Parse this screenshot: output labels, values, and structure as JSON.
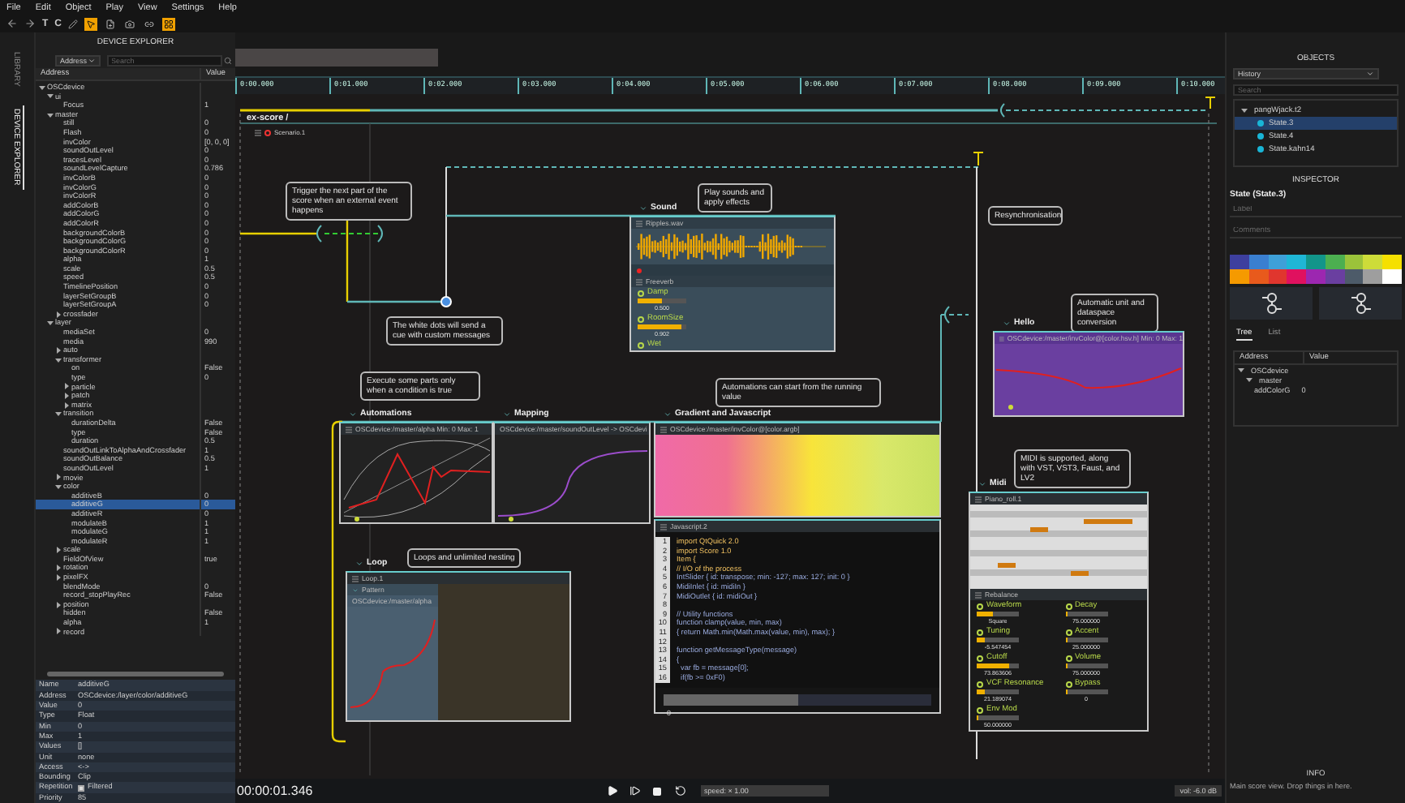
{
  "menu": [
    "File",
    "Edit",
    "Object",
    "Play",
    "View",
    "Settings",
    "Help"
  ],
  "toolbar": {
    "glyphs": [
      "T",
      "C"
    ],
    "tools": [
      {
        "kind": "select",
        "selected": true
      },
      {
        "kind": "create",
        "selected": false
      },
      {
        "kind": "play",
        "selected": false
      },
      {
        "kind": "link",
        "selected": false
      },
      {
        "kind": "layout",
        "selected": true
      }
    ]
  },
  "side_tabs": [
    {
      "label": "LIBRARY",
      "selected": false
    },
    {
      "label": "DEVICE EXPLORER",
      "selected": true
    }
  ],
  "device_explorer": {
    "title": "DEVICE EXPLORER",
    "filter": "Address",
    "search": {
      "placeholder": "Search"
    },
    "columns": [
      "Address",
      "Value"
    ],
    "tree": [
      {
        "label": "OSCdevice",
        "expanded": true,
        "selected": false,
        "children": [
          {
            "label": "ui",
            "expanded": true,
            "selected": false,
            "children": [
              {
                "label": "Focus",
                "value": "1",
                "selected": false
              }
            ]
          },
          {
            "label": "master",
            "expanded": true,
            "selected": false,
            "children": [
              {
                "label": "still",
                "value": "0",
                "selected": false
              },
              {
                "label": "Flash",
                "value": "0",
                "selected": false
              },
              {
                "label": "invColor",
                "value": "[0, 0, 0]",
                "selected": false
              },
              {
                "label": "soundOutLevel",
                "value": "0",
                "selected": false
              },
              {
                "label": "tracesLevel",
                "value": "0",
                "selected": false
              },
              {
                "label": "soundLevelCapture",
                "value": "0.786",
                "selected": false
              },
              {
                "label": "invColorB",
                "value": "0",
                "selected": false
              },
              {
                "label": "invColorG",
                "value": "0",
                "selected": false
              },
              {
                "label": "invColorR",
                "value": "0",
                "selected": false
              },
              {
                "label": "addColorB",
                "value": "0",
                "selected": false
              },
              {
                "label": "addColorG",
                "value": "0",
                "selected": false
              },
              {
                "label": "addColorR",
                "value": "0",
                "selected": false
              },
              {
                "label": "backgroundColorB",
                "value": "0",
                "selected": false
              },
              {
                "label": "backgroundColorG",
                "value": "0",
                "selected": false
              },
              {
                "label": "backgroundColorR",
                "value": "0",
                "selected": false
              },
              {
                "label": "alpha",
                "value": "1",
                "selected": false
              },
              {
                "label": "scale",
                "value": "0.5",
                "selected": false
              },
              {
                "label": "speed",
                "value": "0.5",
                "selected": false
              },
              {
                "label": "TimelinePosition",
                "value": "0",
                "selected": false
              },
              {
                "label": "layerSetGroupB",
                "value": "0",
                "selected": false
              },
              {
                "label": "layerSetGroupA",
                "value": "0",
                "selected": false
              },
              {
                "label": "crossfader",
                "expanded": false,
                "selected": false
              }
            ]
          },
          {
            "label": "layer",
            "expanded": true,
            "selected": false,
            "children": [
              {
                "label": "mediaSet",
                "value": "0",
                "selected": false
              },
              {
                "label": "media",
                "value": "990",
                "selected": false
              },
              {
                "label": "auto",
                "expanded": false,
                "selected": false
              },
              {
                "label": "transformer",
                "expanded": true,
                "selected": false,
                "children": [
                  {
                    "label": "on",
                    "value": "False",
                    "selected": false
                  },
                  {
                    "label": "type",
                    "value": "0",
                    "selected": false
                  },
                  {
                    "label": "particle",
                    "expanded": false,
                    "selected": false
                  },
                  {
                    "label": "patch",
                    "expanded": false,
                    "selected": false
                  },
                  {
                    "label": "matrix",
                    "expanded": false,
                    "selected": false
                  }
                ]
              },
              {
                "label": "transition",
                "expanded": true,
                "selected": false,
                "children": [
                  {
                    "label": "durationDelta",
                    "value": "False",
                    "selected": false
                  },
                  {
                    "label": "type",
                    "value": "False",
                    "selected": false
                  },
                  {
                    "label": "duration",
                    "value": "0.5",
                    "selected": false
                  }
                ]
              },
              {
                "label": "soundOutLinkToAlphaAndCrossfader",
                "value": "1",
                "selected": false
              },
              {
                "label": "soundOutBalance",
                "value": "0.5",
                "selected": false
              },
              {
                "label": "soundOutLevel",
                "value": "1",
                "selected": false
              },
              {
                "label": "movie",
                "expanded": false,
                "selected": false
              },
              {
                "label": "color",
                "expanded": true,
                "selected": false,
                "children": [
                  {
                    "label": "additiveB",
                    "value": "0",
                    "selected": false
                  },
                  {
                    "label": "additiveG",
                    "value": "0",
                    "selected": true
                  },
                  {
                    "label": "additiveR",
                    "value": "0",
                    "selected": false
                  },
                  {
                    "label": "modulateB",
                    "value": "1",
                    "selected": false
                  },
                  {
                    "label": "modulateG",
                    "value": "1",
                    "selected": false
                  },
                  {
                    "label": "modulateR",
                    "value": "1",
                    "selected": false
                  }
                ]
              },
              {
                "label": "scale",
                "expanded": false,
                "selected": false
              },
              {
                "label": "FieldOfView",
                "value": "true",
                "selected": false
              },
              {
                "label": "rotation",
                "expanded": false,
                "selected": false
              },
              {
                "label": "pixelFX",
                "expanded": false,
                "selected": false
              },
              {
                "label": "blendMode",
                "value": "0",
                "selected": false
              },
              {
                "label": "record_stopPlayRec",
                "value": "False",
                "selected": false
              },
              {
                "label": "position",
                "expanded": false,
                "selected": false
              },
              {
                "label": "hidden",
                "value": "False",
                "selected": false
              },
              {
                "label": "alpha",
                "value": "1",
                "selected": false
              },
              {
                "label": "record",
                "expanded": false,
                "selected": false
              }
            ]
          }
        ]
      }
    ],
    "properties": [
      {
        "name": "Name",
        "value": "additiveG"
      },
      {
        "name": "Address",
        "value": "OSCdevice:/layer/color/additiveG"
      },
      {
        "name": "Value",
        "value": "0"
      },
      {
        "name": "Type",
        "value": "Float"
      },
      {
        "name": "Min",
        "value": "0"
      },
      {
        "name": "Max",
        "value": "1"
      },
      {
        "name": "Values",
        "value": "[]"
      },
      {
        "name": "Unit",
        "value": "none"
      },
      {
        "name": "Access",
        "value": "<->"
      },
      {
        "name": "Bounding",
        "value": "Clip"
      },
      {
        "name": "Repetition",
        "value": "Filtered",
        "checked": true
      },
      {
        "name": "Priority",
        "value": "85"
      }
    ]
  },
  "timeline": {
    "ruler": [
      "0:00.000",
      "0:01.000",
      "0:02.000",
      "0:03.000",
      "0:04.000",
      "0:05.000",
      "0:06.000",
      "0:07.000",
      "0:08.000",
      "0:09.000",
      "0:10.000"
    ],
    "score_title": "ex-score /",
    "scenario": "Scenario.1"
  },
  "comments": [
    "Trigger the next part  of the score when an external event happens",
    "Play sounds and apply effects",
    "Resynchronisation",
    "The white dots will send a cue with custom messages",
    "Automatic unit and dataspace conversion",
    "Execute some parts only when a condition is true",
    "Automations can start from the running value",
    "MIDI is supported, along with VST, VST3, Faust, and LV2",
    "Loops and unlimited nesting"
  ],
  "processes": {
    "sound": {
      "title": "Sound",
      "file": "Ripples.wav",
      "effect": "Freeverb",
      "params": [
        {
          "label": "Damp",
          "level": 0.5,
          "reading": "0.500"
        },
        {
          "label": "RoomSize",
          "level": 0.9,
          "reading": "0.902"
        },
        {
          "label": "Wet"
        }
      ]
    },
    "hello": {
      "title": "Hello",
      "address": "OSCdevice:/master/invColor@[color.hsv.h]  Min: 0  Max: 1"
    },
    "automations": {
      "title": "Automations",
      "address": "OSCdevice:/master/alpha  Min: 0  Max: 1"
    },
    "mapping": {
      "title": "Mapping",
      "address": "OSCdevice:/master/soundOutLevel -> OSCdevi"
    },
    "gradient": {
      "title": "Gradient and Javascript",
      "address": "OSCdevice:/master/invColor@[color.argb]"
    },
    "javascript": {
      "title": "Javascript.2",
      "lines": [
        {
          "n": "1",
          "text": "import QtQuick 2.0"
        },
        {
          "n": "2",
          "text": "import Score 1.0"
        },
        {
          "n": "3",
          "text": "Item {"
        },
        {
          "n": "4",
          "text": "// I/O of the process"
        },
        {
          "n": "5",
          "text": "IntSlider { id: transpose; min: -127; max: 127; init: 0 }"
        },
        {
          "n": "6",
          "text": "MidiInlet { id: midiIn }"
        },
        {
          "n": "7",
          "text": "MidiOutlet { id: midiOut }"
        },
        {
          "n": "8"
        },
        {
          "n": "9",
          "text": "// Utility functions"
        },
        {
          "n": "10",
          "text": "function clamp(value, min, max)"
        },
        {
          "n": "11",
          "text": "{ return Math.min(Math.max(value, min), max); }"
        },
        {
          "n": "12"
        },
        {
          "n": "13",
          "text": "function getMessageType(message)"
        },
        {
          "n": "14",
          "text": "{"
        },
        {
          "n": "15",
          "text": "  var fb = message[0];"
        },
        {
          "n": "16",
          "text": "  if(fb >= 0xF0)"
        }
      ],
      "slider": {
        "level": 0.5,
        "reading": "0"
      }
    },
    "loop": {
      "title": "Loop",
      "name": "Loop.1",
      "pattern": "Pattern",
      "address": "OSCdevice:/master/alpha"
    },
    "midi": {
      "title": "Midi",
      "roll": "Piano_roll.1",
      "synth": "Rebalance",
      "params": [
        {
          "label": "Waveform",
          "level": 0.4,
          "reading": "Square"
        },
        {
          "label": "Decay",
          "level": 0,
          "reading": "75.000000"
        },
        {
          "label": "Tuning",
          "level": 0.2,
          "reading": "-5.547454"
        },
        {
          "label": "Accent",
          "level": 0,
          "reading": "25.000000"
        },
        {
          "label": "Cutoff",
          "level": 0.75,
          "reading": "73.863606"
        },
        {
          "label": "Volume",
          "level": 0,
          "reading": "75.000000"
        },
        {
          "label": "VCF Resonance",
          "level": 0.2,
          "reading": "21.189074"
        },
        {
          "label": "Bypass",
          "level": 0,
          "reading": "0"
        },
        {
          "label": "Env Mod",
          "level": 0,
          "reading": "50.000000"
        }
      ]
    }
  },
  "transport": {
    "time": "00:00:01.346",
    "speed": "speed: × 1.00",
    "volume": "vol: -6.0 dB"
  },
  "objects": {
    "title": "OBJECTS",
    "dropdown": "History",
    "search": {
      "placeholder": "Search"
    },
    "tree": [
      {
        "label": "pangWjack.t2",
        "expanded": true,
        "selected": false,
        "children": [
          {
            "label": "State.3",
            "selected": true
          },
          {
            "label": "State.4",
            "selected": false
          },
          {
            "label": "State.kahn14",
            "selected": false
          }
        ]
      }
    ]
  },
  "inspector": {
    "title": "INSPECTOR",
    "heading": "State (State.3)",
    "label": {
      "placeholder": "Label"
    },
    "comments": {
      "placeholder": "Comments"
    },
    "palette": [
      {
        "color": "#3d3f9e"
      },
      {
        "color": "#3a7fd0"
      },
      {
        "color": "#3ea0d8"
      },
      {
        "color": "#1fb6d6"
      },
      {
        "color": "#12958a"
      },
      {
        "color": "#4caf50"
      },
      {
        "color": "#9bc33a"
      },
      {
        "color": "#cddc39"
      },
      {
        "color": "#f5e000"
      },
      {
        "color": "#f59a00"
      },
      {
        "color": "#e85a1c"
      },
      {
        "color": "#e0362e"
      },
      {
        "color": "#e0115f"
      },
      {
        "color": "#9c27b0"
      },
      {
        "color": "#6a3fa0"
      },
      {
        "color": "#4d5b69"
      },
      {
        "color": "#9e9e9e"
      },
      {
        "color": "#ffffff"
      }
    ],
    "tabs": [
      {
        "label": "Tree",
        "selected": true
      },
      {
        "label": "List",
        "selected": false
      }
    ],
    "columns": [
      "Address",
      "Value"
    ],
    "tree": [
      {
        "label": "OSCdevice",
        "expanded": true,
        "children": [
          {
            "label": "master",
            "expanded": true,
            "children": [
              {
                "label": "addColorG",
                "value": "0"
              }
            ]
          }
        ]
      }
    ]
  },
  "info": {
    "title": "INFO",
    "text": "Main score view. Drop things in here."
  }
}
